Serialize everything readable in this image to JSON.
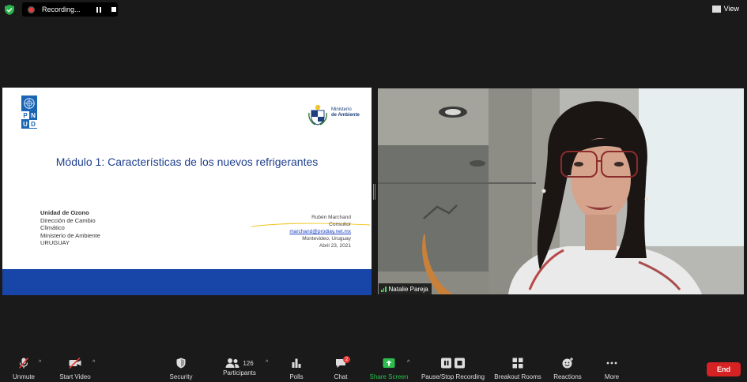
{
  "recording": {
    "label": "Recording..."
  },
  "view": {
    "label": "View"
  },
  "slide": {
    "title": "Módulo 1: Características de los nuevos refrigerantes",
    "org_lines": [
      "Unidad de Ozono",
      "Dirección de Cambio",
      "Climático",
      "Ministerio de Ambiente",
      "URUGUAY"
    ],
    "presenter_lines": [
      "Rubén Marchand",
      "Consultor"
    ],
    "email": "marchand@prodiay.net.mx",
    "location_lines": [
      "Montevideo, Uruguay",
      "Abril 23,  2021"
    ],
    "pnud_letters": [
      "P",
      "N",
      "U",
      "D"
    ],
    "ministerio_line1": "Ministerio",
    "ministerio_line2": "de Ambiente",
    "band_color": "#1845a8"
  },
  "video": {
    "participant_name": "Natalie Pareja"
  },
  "toolbar": {
    "unmute": "Unmute",
    "start_video": "Start Video",
    "security": "Security",
    "participants": "Participants",
    "participants_count": "126",
    "polls": "Polls",
    "chat": "Chat",
    "chat_badge": "2",
    "share_screen": "Share Screen",
    "pause_stop": "Pause/Stop Recording",
    "breakout": "Breakout Rooms",
    "reactions": "Reactions",
    "more": "More",
    "end": "End"
  },
  "colors": {
    "share_green": "#2dbd4e",
    "end_red": "#d62222",
    "record_red": "#e83a3a"
  }
}
